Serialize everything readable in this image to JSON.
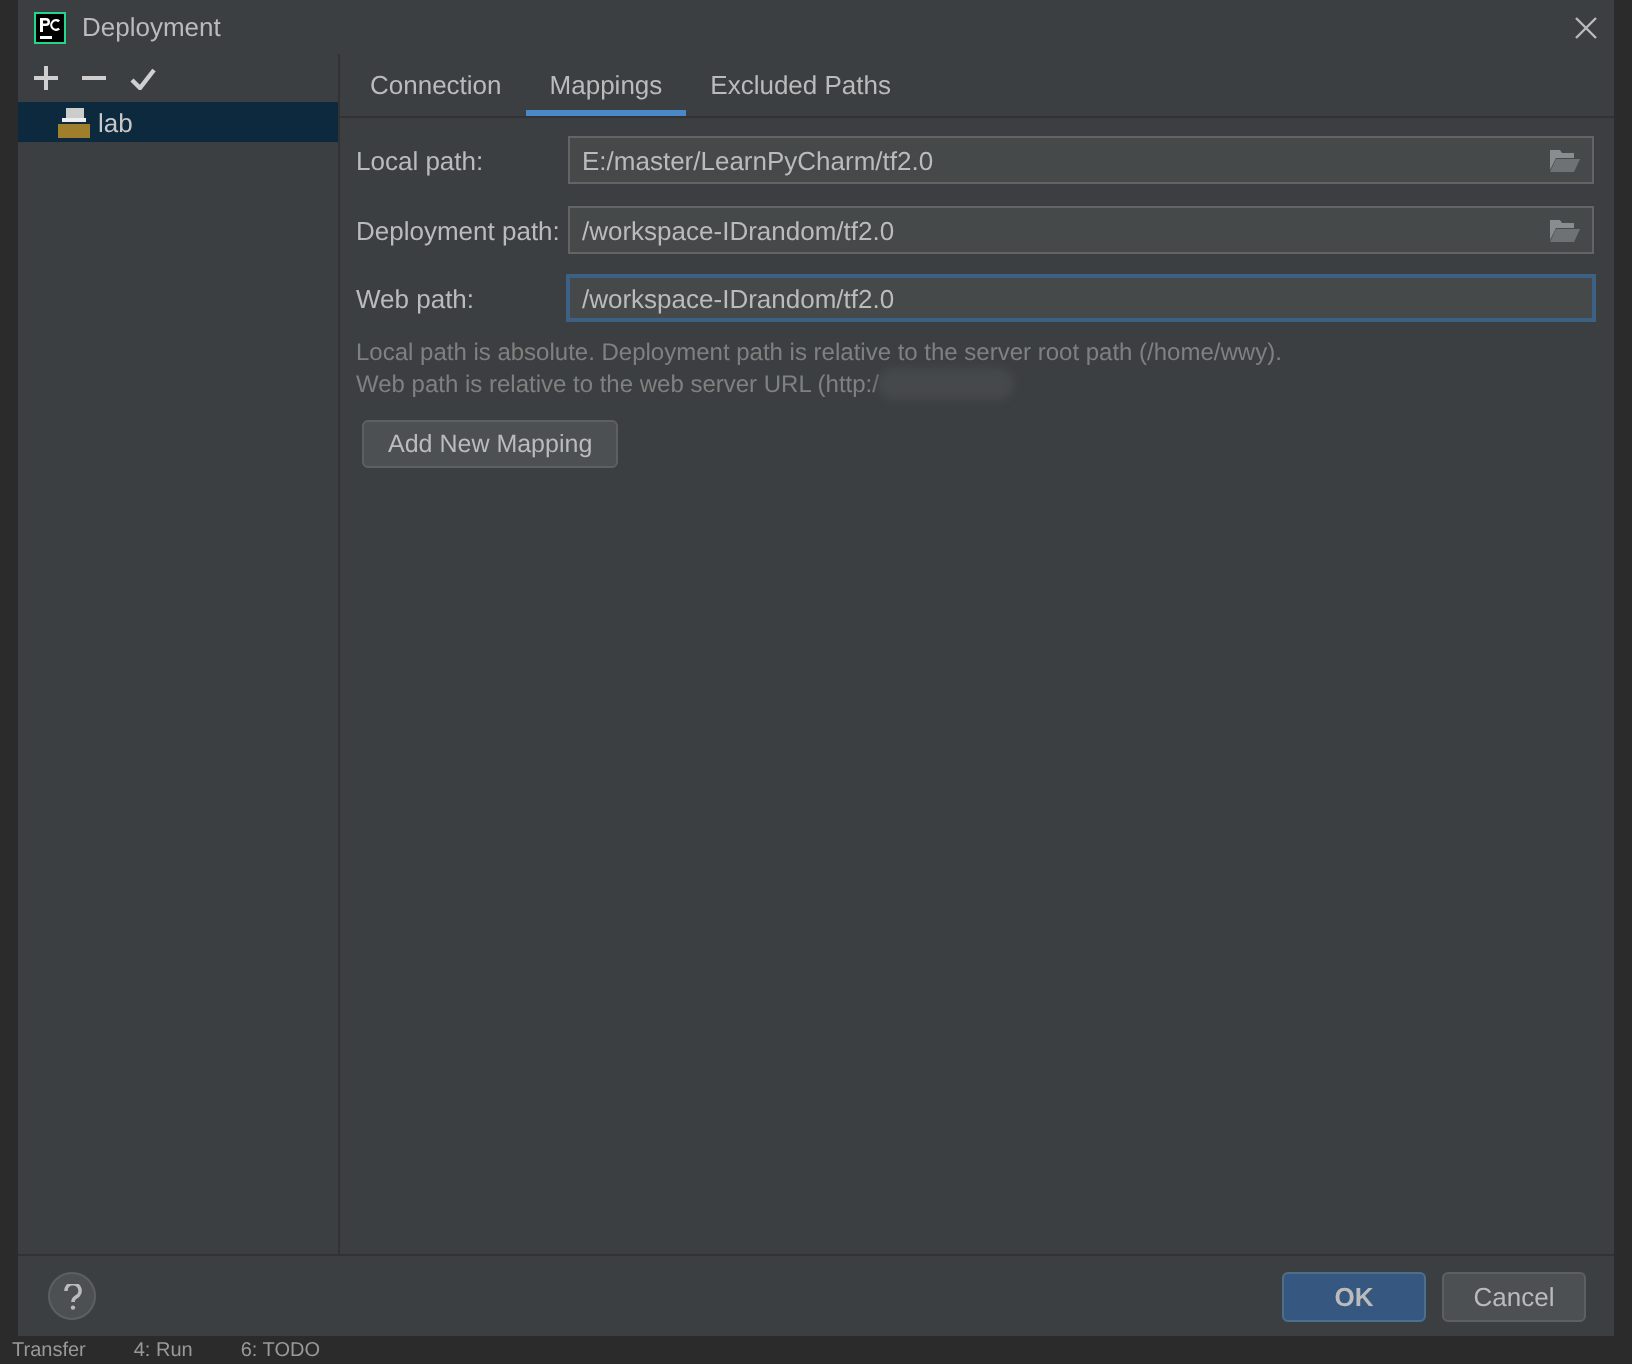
{
  "window": {
    "title": "Deployment"
  },
  "toolbar": [
    {
      "kind": "add"
    },
    {
      "kind": "remove"
    },
    {
      "kind": "check"
    }
  ],
  "servers": [
    {
      "name": "lab",
      "selected": true
    }
  ],
  "tabs": [
    {
      "label": "Connection",
      "selected": false
    },
    {
      "label": "Mappings",
      "selected": true
    },
    {
      "label": "Excluded Paths",
      "selected": false
    }
  ],
  "fields": [
    {
      "label": "Local path:",
      "value": "E:/master/LearnPyCharm/tf2.0",
      "browse": true,
      "focused": false
    },
    {
      "label": "Deployment path:",
      "value": "/workspace-IDrandom/tf2.0",
      "browse": true,
      "focused": false
    },
    {
      "label": "Web path:",
      "value": "/workspace-IDrandom/tf2.0",
      "browse": false,
      "focused": true
    }
  ],
  "hints": [
    "Local path is absolute. Deployment path is relative to the server root path (/home/wwy).",
    "Web path is relative to the web server URL (http:/"
  ],
  "add_button": "Add New Mapping",
  "buttons": [
    {
      "label": "OK",
      "kind": "primary"
    },
    {
      "label": "Cancel",
      "kind": "secondary"
    }
  ],
  "background_tools": [
    "Transfer",
    "4: Run",
    "6: TODO"
  ]
}
